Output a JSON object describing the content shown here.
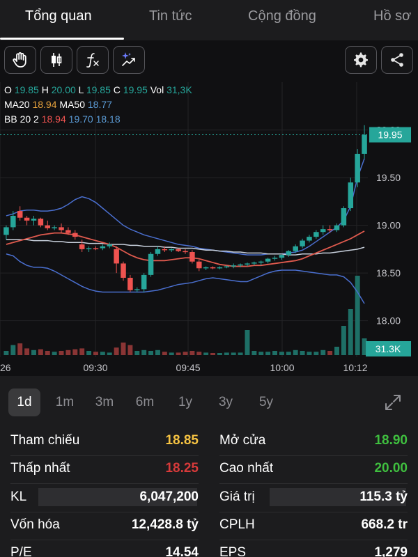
{
  "tabs": [
    "Tổng quan",
    "Tin tức",
    "Cộng đồng",
    "Hồ sơ"
  ],
  "icons": [
    "hand-icon",
    "candlestick-icon",
    "function-icon",
    "ai-trend-icon",
    "gear-icon",
    "share-icon"
  ],
  "legend": {
    "ohlc": {
      "o_label": "O",
      "o": "19.85",
      "h_label": "H",
      "h": "20.00",
      "l_label": "L",
      "l": "19.85",
      "c_label": "C",
      "c": "19.95",
      "vol_label": "Vol",
      "vol": "31,3K"
    },
    "ma": {
      "ma20_label": "MA20",
      "ma20": "18.94",
      "ma50_label": "MA50",
      "ma50": "18.77"
    },
    "bb": {
      "label": "BB 20 2",
      "upper": "18.94",
      "mid": "19.70",
      "lower": "18.18"
    }
  },
  "colors": {
    "up": "#26a69a",
    "down": "#ef5350",
    "ma20": "#e05a4e",
    "ma50": "#c8d0dc",
    "bb": "#4a6fcf",
    "yellow": "#f5c242",
    "green": "#3fbf3f",
    "red": "#d83a3a"
  },
  "chart_data": {
    "type": "candlestick",
    "y_ticks": [
      "20.00",
      "19.50",
      "19.00",
      "18.50",
      "18.00"
    ],
    "x_ticks": [
      "26",
      "09:30",
      "09:45",
      "10:00",
      "10:12"
    ],
    "ylim": [
      17.8,
      20.1
    ],
    "last_price": "19.95",
    "last_volume": "31.3K",
    "candles": [
      [
        18.9,
        19.0,
        18.85,
        18.98
      ],
      [
        18.98,
        19.15,
        18.95,
        19.1
      ],
      [
        19.15,
        19.2,
        19.05,
        19.08
      ],
      [
        19.08,
        19.1,
        19.0,
        19.05
      ],
      [
        19.05,
        19.1,
        19.0,
        19.07
      ],
      [
        19.07,
        19.08,
        18.98,
        19.0
      ],
      [
        19.0,
        19.05,
        18.95,
        18.97
      ],
      [
        18.97,
        19.0,
        18.95,
        18.98
      ],
      [
        18.98,
        19.02,
        18.92,
        18.95
      ],
      [
        18.95,
        18.98,
        18.9,
        18.92
      ],
      [
        18.92,
        18.95,
        18.85,
        18.88
      ],
      [
        18.8,
        18.85,
        18.72,
        18.75
      ],
      [
        18.75,
        18.78,
        18.72,
        18.76
      ],
      [
        18.76,
        18.78,
        18.74,
        18.75
      ],
      [
        18.76,
        18.8,
        18.74,
        18.78
      ],
      [
        18.78,
        18.82,
        18.76,
        18.8
      ],
      [
        18.75,
        18.78,
        18.5,
        18.6
      ],
      [
        18.6,
        18.62,
        18.42,
        18.45
      ],
      [
        18.45,
        18.48,
        18.3,
        18.32
      ],
      [
        18.32,
        18.35,
        18.3,
        18.33
      ],
      [
        18.33,
        18.5,
        18.3,
        18.48
      ],
      [
        18.48,
        18.72,
        18.46,
        18.7
      ],
      [
        18.7,
        18.78,
        18.68,
        18.75
      ],
      [
        18.75,
        18.78,
        18.72,
        18.74
      ],
      [
        18.74,
        18.76,
        18.72,
        18.75
      ],
      [
        18.75,
        18.76,
        18.72,
        18.73
      ],
      [
        18.73,
        18.75,
        18.7,
        18.72
      ],
      [
        18.72,
        18.74,
        18.6,
        18.62
      ],
      [
        18.62,
        18.64,
        18.52,
        18.55
      ],
      [
        18.55,
        18.57,
        18.53,
        18.56
      ],
      [
        18.56,
        18.57,
        18.54,
        18.55
      ],
      [
        18.55,
        18.57,
        18.54,
        18.56
      ],
      [
        18.56,
        18.58,
        18.55,
        18.57
      ],
      [
        18.57,
        18.6,
        18.55,
        18.58
      ],
      [
        18.58,
        18.6,
        18.56,
        18.59
      ],
      [
        18.59,
        18.61,
        18.57,
        18.6
      ],
      [
        18.6,
        18.62,
        18.58,
        18.61
      ],
      [
        18.61,
        18.63,
        18.58,
        18.62
      ],
      [
        18.62,
        18.66,
        18.6,
        18.65
      ],
      [
        18.65,
        18.68,
        18.63,
        18.66
      ],
      [
        18.66,
        18.7,
        18.64,
        18.69
      ],
      [
        18.69,
        18.74,
        18.67,
        18.73
      ],
      [
        18.73,
        18.8,
        18.71,
        18.78
      ],
      [
        18.78,
        18.86,
        18.76,
        18.84
      ],
      [
        18.84,
        18.9,
        18.82,
        18.88
      ],
      [
        18.88,
        18.95,
        18.86,
        18.93
      ],
      [
        18.93,
        19.0,
        18.9,
        18.96
      ],
      [
        18.96,
        19.0,
        18.92,
        18.95
      ],
      [
        18.95,
        19.02,
        18.93,
        19.0
      ],
      [
        19.0,
        19.2,
        18.98,
        19.18
      ],
      [
        19.18,
        19.5,
        19.15,
        19.45
      ],
      [
        19.45,
        19.8,
        19.4,
        19.75
      ],
      [
        19.75,
        20.05,
        19.7,
        19.95
      ]
    ],
    "volumes": [
      0.05,
      0.12,
      0.14,
      0.08,
      0.06,
      0.07,
      0.05,
      0.04,
      0.05,
      0.06,
      0.07,
      0.08,
      0.05,
      0.04,
      0.04,
      0.03,
      0.09,
      0.15,
      0.12,
      0.05,
      0.06,
      0.05,
      0.06,
      0.04,
      0.03,
      0.03,
      0.04,
      0.05,
      0.04,
      0.03,
      0.02,
      0.02,
      0.03,
      0.03,
      0.03,
      0.3,
      0.05,
      0.04,
      0.04,
      0.05,
      0.04,
      0.04,
      0.06,
      0.05,
      0.04,
      0.04,
      0.06,
      0.05,
      0.1,
      0.35,
      0.55,
      0.95,
      0.2
    ],
    "ma20": [
      18.8,
      18.82,
      18.84,
      18.86,
      18.88,
      18.9,
      18.91,
      18.92,
      18.92,
      18.91,
      18.9,
      18.88,
      18.86,
      18.84,
      18.82,
      18.8,
      18.77,
      18.73,
      18.69,
      18.66,
      18.64,
      18.63,
      18.63,
      18.63,
      18.64,
      18.65,
      18.66,
      18.66,
      18.65,
      18.63,
      18.61,
      18.59,
      18.58,
      18.57,
      18.57,
      18.57,
      18.58,
      18.58,
      18.59,
      18.6,
      18.61,
      18.62,
      18.63,
      18.65,
      18.68,
      18.71,
      18.74,
      18.77,
      18.8,
      18.83,
      18.86,
      18.9,
      18.94
    ],
    "ma50": [
      18.85,
      18.85,
      18.85,
      18.85,
      18.84,
      18.84,
      18.84,
      18.83,
      18.83,
      18.82,
      18.82,
      18.82,
      18.81,
      18.81,
      18.81,
      18.8,
      18.8,
      18.8,
      18.79,
      18.79,
      18.78,
      18.78,
      18.78,
      18.77,
      18.77,
      18.76,
      18.76,
      18.76,
      18.75,
      18.74,
      18.74,
      18.73,
      18.73,
      18.72,
      18.72,
      18.71,
      18.71,
      18.71,
      18.7,
      18.7,
      18.7,
      18.69,
      18.69,
      18.7,
      18.7,
      18.7,
      18.71,
      18.71,
      18.72,
      18.73,
      18.74,
      18.75,
      18.77
    ],
    "bb_upper": [
      19.1,
      19.12,
      19.15,
      19.16,
      19.16,
      19.15,
      19.15,
      19.16,
      19.18,
      19.22,
      19.27,
      19.3,
      19.28,
      19.24,
      19.18,
      19.12,
      19.06,
      19.0,
      18.96,
      18.93,
      18.9,
      18.88,
      18.86,
      18.84,
      18.82,
      18.8,
      18.79,
      18.78,
      18.76,
      18.75,
      18.74,
      18.73,
      18.72,
      18.71,
      18.7,
      18.69,
      18.69,
      18.69,
      18.7,
      18.7,
      18.7,
      18.71,
      18.72,
      18.74,
      18.78,
      18.83,
      18.88,
      18.93,
      18.98,
      19.05,
      19.2,
      19.5,
      19.7
    ],
    "bb_lower": [
      18.7,
      18.68,
      18.62,
      18.58,
      18.56,
      18.56,
      18.55,
      18.52,
      18.48,
      18.44,
      18.4,
      18.36,
      18.33,
      18.31,
      18.3,
      18.3,
      18.3,
      18.3,
      18.3,
      18.3,
      18.3,
      18.31,
      18.32,
      18.34,
      18.36,
      18.38,
      18.39,
      18.4,
      18.42,
      18.44,
      18.45,
      18.44,
      18.43,
      18.42,
      18.41,
      18.41,
      18.44,
      18.47,
      18.5,
      18.52,
      18.53,
      18.53,
      18.53,
      18.52,
      18.51,
      18.5,
      18.49,
      18.48,
      18.48,
      18.46,
      18.4,
      18.3,
      18.18
    ]
  },
  "ranges": [
    "1d",
    "1m",
    "3m",
    "6m",
    "1y",
    "3y",
    "5y"
  ],
  "stats": {
    "tham_chieu": {
      "label": "Tham chiếu",
      "value": "18.85"
    },
    "mo_cua": {
      "label": "Mở cửa",
      "value": "18.90"
    },
    "thap_nhat": {
      "label": "Thấp nhất",
      "value": "18.25"
    },
    "cao_nhat": {
      "label": "Cao nhất",
      "value": "20.00"
    },
    "kl": {
      "label": "KL",
      "value": "6,047,200"
    },
    "gia_tri": {
      "label": "Giá trị",
      "value": "115.3 tỷ"
    },
    "von_hoa": {
      "label": "Vốn hóa",
      "value": "12,428.8 tỷ"
    },
    "cplh": {
      "label": "CPLH",
      "value": "668.2 tr"
    },
    "pe": {
      "label": "P/E",
      "value": "14.54"
    },
    "eps": {
      "label": "EPS",
      "value": "1,279"
    }
  }
}
